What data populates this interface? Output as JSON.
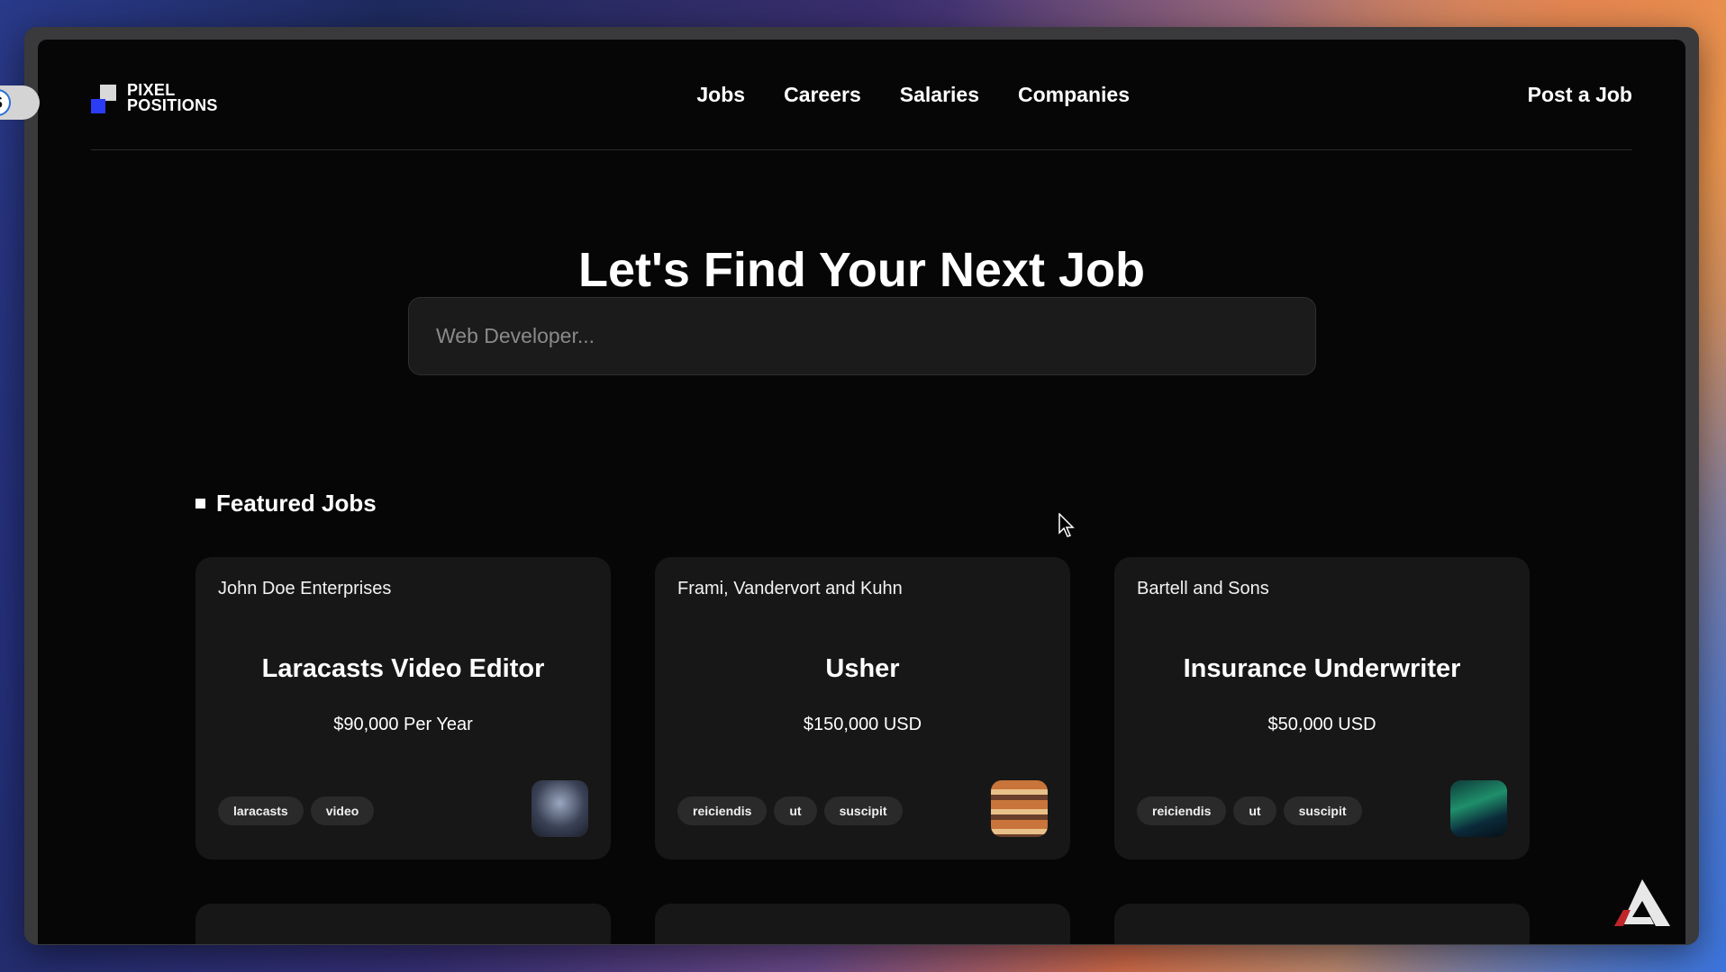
{
  "brand": {
    "line1": "PIXEL",
    "line2": "POSITIONS"
  },
  "toggle": {
    "letter": "S"
  },
  "nav": {
    "links": [
      "Jobs",
      "Careers",
      "Salaries",
      "Companies"
    ],
    "post_job": "Post a Job"
  },
  "hero": {
    "title": "Let's Find Your Next Job",
    "search_placeholder": "Web Developer..."
  },
  "featured": {
    "heading": "Featured Jobs",
    "jobs": [
      {
        "employer": "John Doe Enterprises",
        "title": "Laracasts Video Editor",
        "salary": "$90,000 Per Year",
        "tags": [
          "laracasts",
          "video"
        ]
      },
      {
        "employer": "Frami, Vandervort and Kuhn",
        "title": "Usher",
        "salary": "$150,000 USD",
        "tags": [
          "reiciendis",
          "ut",
          "suscipit"
        ]
      },
      {
        "employer": "Bartell and Sons",
        "title": "Insurance Underwriter",
        "salary": "$50,000 USD",
        "tags": [
          "reiciendis",
          "ut",
          "suscipit"
        ]
      }
    ]
  },
  "colors": {
    "accent": "#2a3cf5",
    "background": "#060606",
    "card": "#171717"
  }
}
